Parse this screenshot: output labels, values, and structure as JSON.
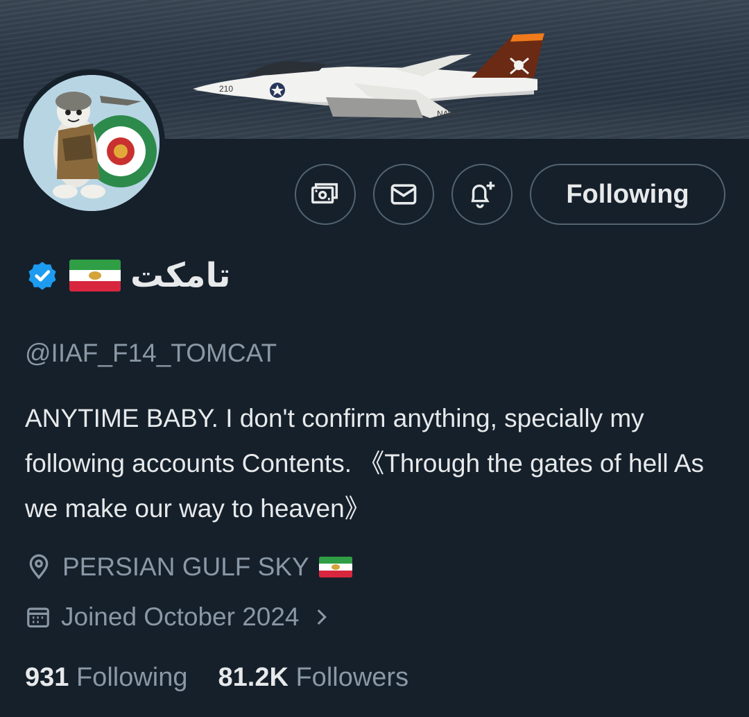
{
  "profile": {
    "display_name": "تامکت",
    "handle": "@IIAF_F14_TOMCAT",
    "bio": "ANYTIME BABY. I don't confirm anything, specially my following accounts Contents.   《Through the gates of hell As we make our way to heaven》",
    "location": "PERSIAN GULF SKY",
    "joined": "Joined October 2024",
    "verified": true
  },
  "actions": {
    "follow_label": "Following"
  },
  "stats": {
    "following_count": "931",
    "following_label": "Following",
    "followers_count": "81.2K",
    "followers_label": "Followers"
  },
  "icons": {
    "tip": "money-icon",
    "message": "envelope-icon",
    "notify": "bell-plus-icon",
    "verified": "verified-badge-icon",
    "location": "location-pin-icon",
    "calendar": "calendar-icon",
    "chevron": "chevron-right-icon"
  },
  "colors": {
    "background": "#15202b",
    "text": "#e7e9ea",
    "muted": "#8b98a5",
    "border": "#536471",
    "verified": "#1d9bf0"
  }
}
